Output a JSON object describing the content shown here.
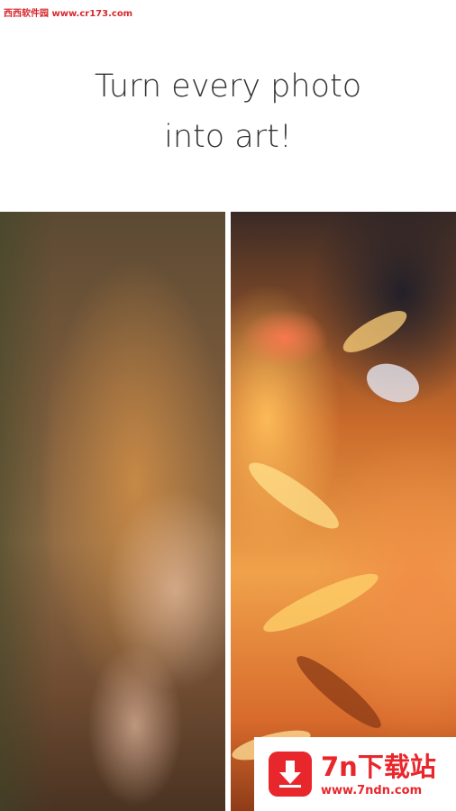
{
  "watermark_top": "西西软件园 www.cr173.com",
  "headline": {
    "line1": "Turn every photo",
    "line2": "into art!"
  },
  "comparison": {
    "left": "original-photo",
    "right": "art-filtered-photo"
  },
  "brand_badge": {
    "name": "7n下载站",
    "url": "www.7ndn.com",
    "icon": "download-arrow-icon",
    "color": "#e8272d"
  }
}
